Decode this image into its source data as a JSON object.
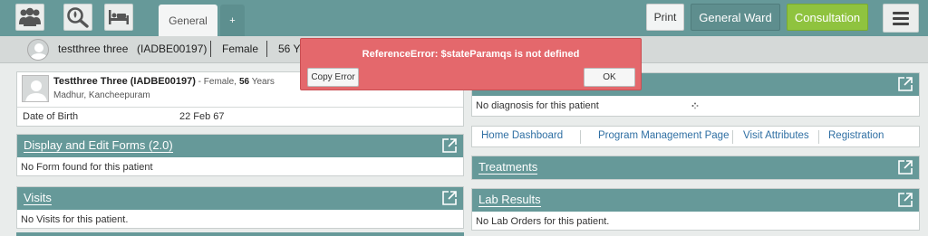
{
  "toolbar": {
    "tabs": [
      {
        "label": "General"
      },
      {
        "label": "+"
      }
    ],
    "print_label": "Print",
    "ward_label": "General Ward",
    "consultation_label": "Consultation"
  },
  "patient_strip": {
    "name": "testthree three",
    "id": "(IADBE00197)",
    "gender": "Female",
    "age": "56 Ye"
  },
  "patient_info": {
    "name": "Testthree Three (IADBE00197)",
    "sep": " - ",
    "gender": "Female,",
    "age_num": "56",
    "age_unit": " Years",
    "address": "Madhur, Kancheepuram",
    "dob_label": "Date of Birth",
    "dob_value": "22 Feb 67"
  },
  "panels": {
    "forms": {
      "title": "Display and Edit Forms (2.0)",
      "empty": "No Form found for this patient"
    },
    "visits": {
      "title": "Visits",
      "empty": "No Visits for this patient."
    },
    "diagnosis": {
      "empty": "No diagnosis for this patient"
    },
    "treatments": {
      "title": "Treatments"
    },
    "lab": {
      "title": "Lab Results",
      "empty": "No Lab Orders for this patient."
    }
  },
  "links": [
    "Home Dashboard",
    "Program Management Page",
    "Visit Attributes",
    "Registration"
  ],
  "error_dialog": {
    "message": "ReferenceError: $stateParamqs is not defined",
    "copy_label": "Copy Error",
    "ok_label": "OK"
  },
  "colors": {
    "header": "#669999",
    "consultation": "#8fc33f",
    "error": "#e4686c",
    "link": "#2f6fa3"
  }
}
